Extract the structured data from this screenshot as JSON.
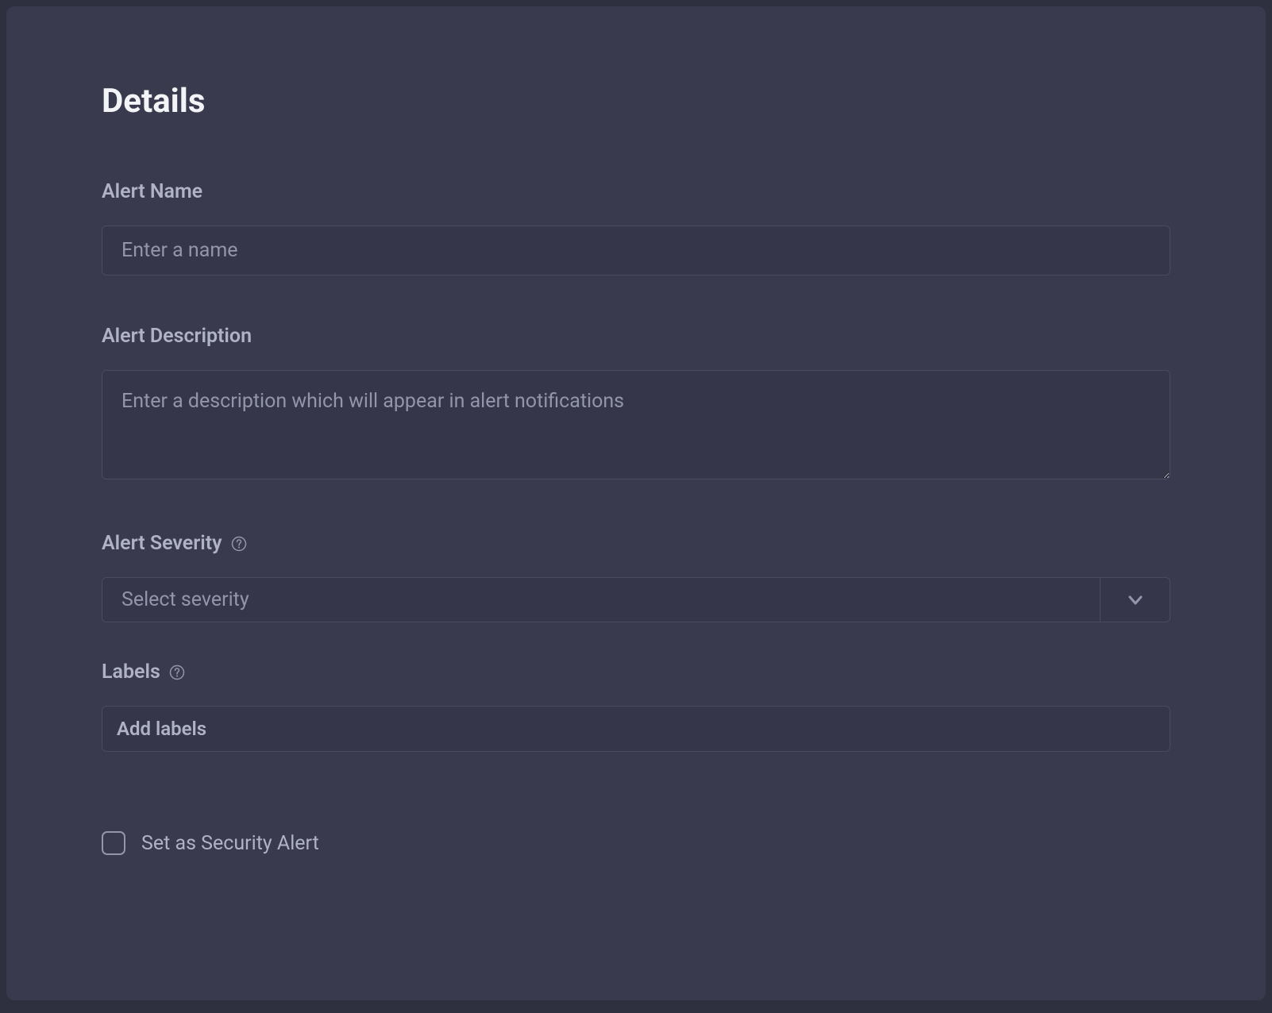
{
  "title": "Details",
  "fields": {
    "alertName": {
      "label": "Alert Name",
      "placeholder": "Enter a name",
      "value": ""
    },
    "alertDescription": {
      "label": "Alert Description",
      "placeholder": "Enter a description which will appear in alert notifications",
      "value": ""
    },
    "alertSeverity": {
      "label": "Alert Severity",
      "placeholder": "Select severity",
      "value": ""
    },
    "labels": {
      "label": "Labels",
      "placeholder": "Add labels",
      "value": ""
    }
  },
  "securityAlert": {
    "label": "Set as Security Alert",
    "checked": false
  }
}
